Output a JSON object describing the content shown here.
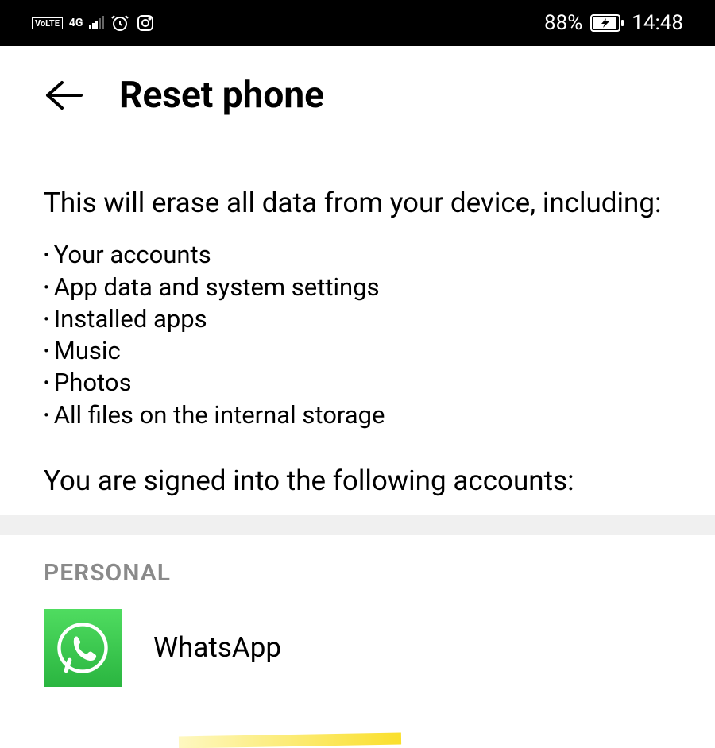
{
  "status_bar": {
    "volte_label": "VoLTE",
    "network_label": "4G",
    "battery_percent": "88%",
    "time": "14:48"
  },
  "header": {
    "title": "Reset phone"
  },
  "content": {
    "warning": "This will erase all data from your device, including:",
    "erase_items": [
      "Your accounts",
      "App data and system settings",
      "Installed apps",
      "Music",
      "Photos",
      "All files on the internal storage"
    ],
    "signed_in": "You are signed into the following accounts:"
  },
  "accounts": {
    "section_label": "PERSONAL",
    "items": [
      {
        "name": "WhatsApp",
        "icon": "whatsapp"
      }
    ]
  }
}
